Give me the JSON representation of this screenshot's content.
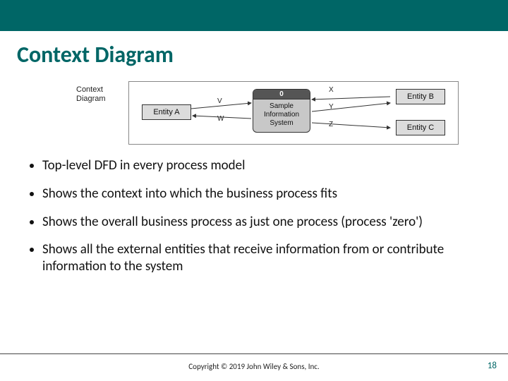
{
  "title": "Context Diagram",
  "diagram": {
    "label_line1": "Context",
    "label_line2": "Diagram",
    "process_number": "0",
    "process_name": "Sample Information System",
    "entities": {
      "A": "Entity A",
      "B": "Entity B",
      "C": "Entity C"
    },
    "flows": {
      "V": "V",
      "W": "W",
      "X": "X",
      "Y": "Y",
      "Z": "Z"
    }
  },
  "bullets": [
    "Top-level DFD in every process model",
    "Shows the context into which the business process fits",
    "Shows the overall business process as just one process (process 'zero')",
    "Shows all the external entities that receive information from or contribute information to the system"
  ],
  "copyright": "Copyright © 2019 John Wiley & Sons, Inc.",
  "page_number": "18"
}
